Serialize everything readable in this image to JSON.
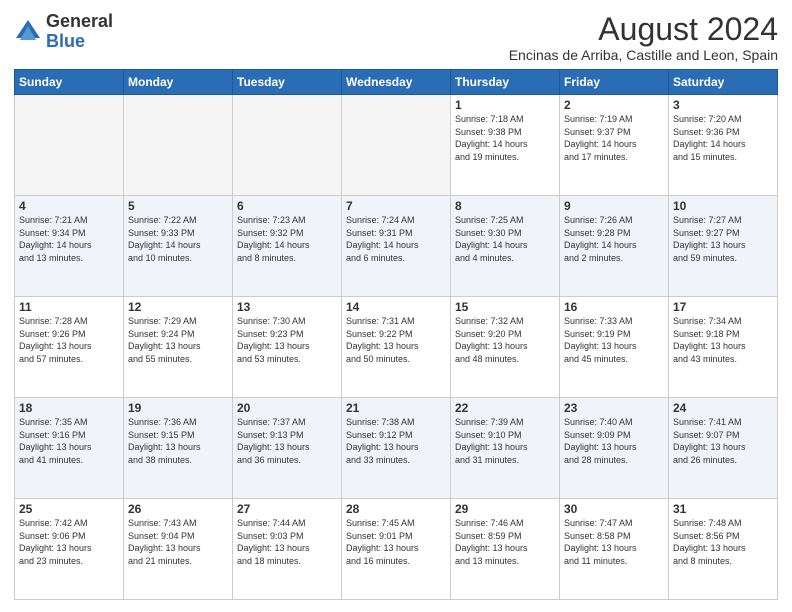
{
  "logo": {
    "general": "General",
    "blue": "Blue"
  },
  "title": "August 2024",
  "location": "Encinas de Arriba, Castille and Leon, Spain",
  "weekdays": [
    "Sunday",
    "Monday",
    "Tuesday",
    "Wednesday",
    "Thursday",
    "Friday",
    "Saturday"
  ],
  "weeks": [
    [
      {
        "day": "",
        "info": ""
      },
      {
        "day": "",
        "info": ""
      },
      {
        "day": "",
        "info": ""
      },
      {
        "day": "",
        "info": ""
      },
      {
        "day": "1",
        "info": "Sunrise: 7:18 AM\nSunset: 9:38 PM\nDaylight: 14 hours\nand 19 minutes."
      },
      {
        "day": "2",
        "info": "Sunrise: 7:19 AM\nSunset: 9:37 PM\nDaylight: 14 hours\nand 17 minutes."
      },
      {
        "day": "3",
        "info": "Sunrise: 7:20 AM\nSunset: 9:36 PM\nDaylight: 14 hours\nand 15 minutes."
      }
    ],
    [
      {
        "day": "4",
        "info": "Sunrise: 7:21 AM\nSunset: 9:34 PM\nDaylight: 14 hours\nand 13 minutes."
      },
      {
        "day": "5",
        "info": "Sunrise: 7:22 AM\nSunset: 9:33 PM\nDaylight: 14 hours\nand 10 minutes."
      },
      {
        "day": "6",
        "info": "Sunrise: 7:23 AM\nSunset: 9:32 PM\nDaylight: 14 hours\nand 8 minutes."
      },
      {
        "day": "7",
        "info": "Sunrise: 7:24 AM\nSunset: 9:31 PM\nDaylight: 14 hours\nand 6 minutes."
      },
      {
        "day": "8",
        "info": "Sunrise: 7:25 AM\nSunset: 9:30 PM\nDaylight: 14 hours\nand 4 minutes."
      },
      {
        "day": "9",
        "info": "Sunrise: 7:26 AM\nSunset: 9:28 PM\nDaylight: 14 hours\nand 2 minutes."
      },
      {
        "day": "10",
        "info": "Sunrise: 7:27 AM\nSunset: 9:27 PM\nDaylight: 13 hours\nand 59 minutes."
      }
    ],
    [
      {
        "day": "11",
        "info": "Sunrise: 7:28 AM\nSunset: 9:26 PM\nDaylight: 13 hours\nand 57 minutes."
      },
      {
        "day": "12",
        "info": "Sunrise: 7:29 AM\nSunset: 9:24 PM\nDaylight: 13 hours\nand 55 minutes."
      },
      {
        "day": "13",
        "info": "Sunrise: 7:30 AM\nSunset: 9:23 PM\nDaylight: 13 hours\nand 53 minutes."
      },
      {
        "day": "14",
        "info": "Sunrise: 7:31 AM\nSunset: 9:22 PM\nDaylight: 13 hours\nand 50 minutes."
      },
      {
        "day": "15",
        "info": "Sunrise: 7:32 AM\nSunset: 9:20 PM\nDaylight: 13 hours\nand 48 minutes."
      },
      {
        "day": "16",
        "info": "Sunrise: 7:33 AM\nSunset: 9:19 PM\nDaylight: 13 hours\nand 45 minutes."
      },
      {
        "day": "17",
        "info": "Sunrise: 7:34 AM\nSunset: 9:18 PM\nDaylight: 13 hours\nand 43 minutes."
      }
    ],
    [
      {
        "day": "18",
        "info": "Sunrise: 7:35 AM\nSunset: 9:16 PM\nDaylight: 13 hours\nand 41 minutes."
      },
      {
        "day": "19",
        "info": "Sunrise: 7:36 AM\nSunset: 9:15 PM\nDaylight: 13 hours\nand 38 minutes."
      },
      {
        "day": "20",
        "info": "Sunrise: 7:37 AM\nSunset: 9:13 PM\nDaylight: 13 hours\nand 36 minutes."
      },
      {
        "day": "21",
        "info": "Sunrise: 7:38 AM\nSunset: 9:12 PM\nDaylight: 13 hours\nand 33 minutes."
      },
      {
        "day": "22",
        "info": "Sunrise: 7:39 AM\nSunset: 9:10 PM\nDaylight: 13 hours\nand 31 minutes."
      },
      {
        "day": "23",
        "info": "Sunrise: 7:40 AM\nSunset: 9:09 PM\nDaylight: 13 hours\nand 28 minutes."
      },
      {
        "day": "24",
        "info": "Sunrise: 7:41 AM\nSunset: 9:07 PM\nDaylight: 13 hours\nand 26 minutes."
      }
    ],
    [
      {
        "day": "25",
        "info": "Sunrise: 7:42 AM\nSunset: 9:06 PM\nDaylight: 13 hours\nand 23 minutes."
      },
      {
        "day": "26",
        "info": "Sunrise: 7:43 AM\nSunset: 9:04 PM\nDaylight: 13 hours\nand 21 minutes."
      },
      {
        "day": "27",
        "info": "Sunrise: 7:44 AM\nSunset: 9:03 PM\nDaylight: 13 hours\nand 18 minutes."
      },
      {
        "day": "28",
        "info": "Sunrise: 7:45 AM\nSunset: 9:01 PM\nDaylight: 13 hours\nand 16 minutes."
      },
      {
        "day": "29",
        "info": "Sunrise: 7:46 AM\nSunset: 8:59 PM\nDaylight: 13 hours\nand 13 minutes."
      },
      {
        "day": "30",
        "info": "Sunrise: 7:47 AM\nSunset: 8:58 PM\nDaylight: 13 hours\nand 11 minutes."
      },
      {
        "day": "31",
        "info": "Sunrise: 7:48 AM\nSunset: 8:56 PM\nDaylight: 13 hours\nand 8 minutes."
      }
    ]
  ]
}
